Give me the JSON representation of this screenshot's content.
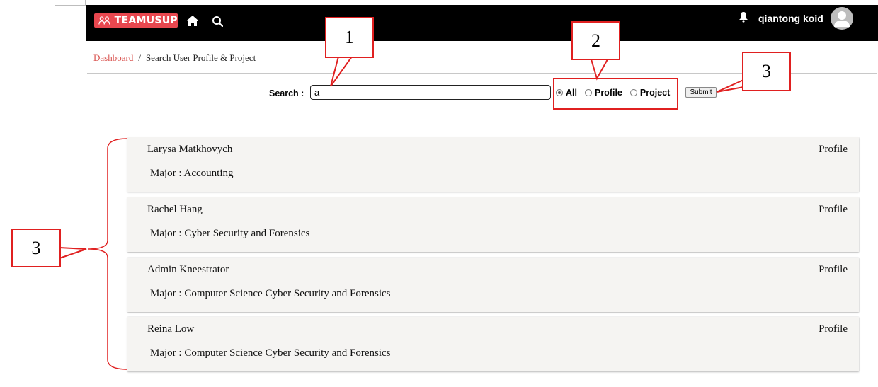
{
  "app": {
    "logo_text": "TEAMUSUP",
    "user_name": "qiantong koid"
  },
  "breadcrumb": {
    "home": "Dashboard",
    "separator": "/",
    "current": "Search User Profile & Project"
  },
  "search": {
    "label": "Search :",
    "value": "a",
    "radios": [
      {
        "label": "All",
        "checked": true
      },
      {
        "label": "Profile",
        "checked": false
      },
      {
        "label": "Project",
        "checked": false
      }
    ],
    "submit_label": "Submit"
  },
  "results": [
    {
      "name": "Larysa Matkhovych",
      "type": "Profile",
      "major": "Major : Accounting"
    },
    {
      "name": "Rachel Hang",
      "type": "Profile",
      "major": "Major : Cyber Security and Forensics"
    },
    {
      "name": "Admin Kneestrator",
      "type": "Profile",
      "major": "Major : Computer Science Cyber Security and Forensics"
    },
    {
      "name": "Reina Low",
      "type": "Profile",
      "major": "Major : Computer Science Cyber Security and Forensics"
    }
  ],
  "annotations": {
    "label_1": "1",
    "label_2": "2",
    "label_3_submit": "3",
    "label_3_results": "3"
  },
  "colors": {
    "brand": "#e8474f",
    "navbar": "#000000",
    "annotation": "#e02020"
  }
}
